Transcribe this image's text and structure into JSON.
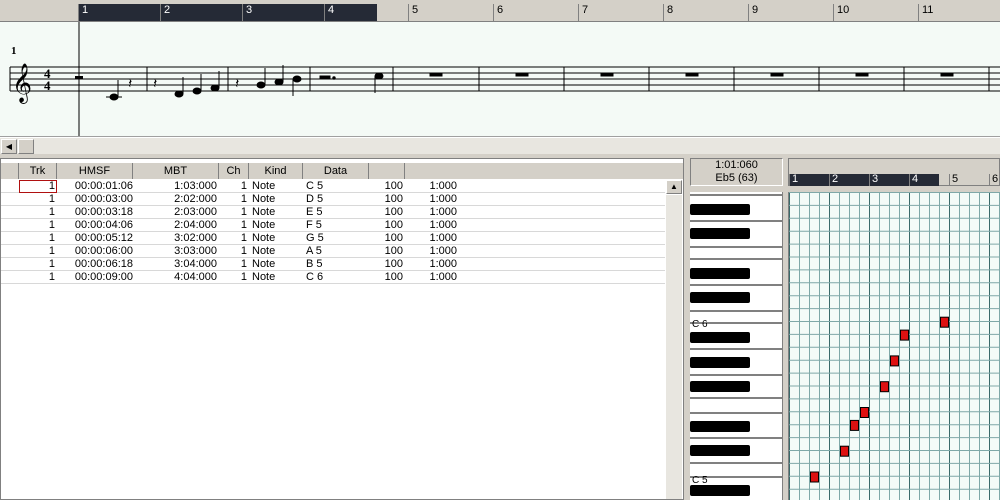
{
  "ruler": {
    "measures": [
      "1",
      "2",
      "3",
      "4",
      "5",
      "6",
      "7",
      "8",
      "9",
      "10",
      "11"
    ],
    "selected_range": [
      1,
      4
    ]
  },
  "staff": {
    "measure_number": "1",
    "time_signature": {
      "top": "4",
      "bottom": "4"
    }
  },
  "event_list": {
    "columns": [
      "Trk",
      "HMSF",
      "MBT",
      "Ch",
      "Kind",
      "Data"
    ],
    "rows": [
      {
        "trk": "1",
        "hmsf": "00:00:01:06",
        "mbt": "1:03:000",
        "ch": "1",
        "kind": "Note",
        "data": "C 5",
        "vel": "100",
        "dur": "1:000"
      },
      {
        "trk": "1",
        "hmsf": "00:00:03:00",
        "mbt": "2:02:000",
        "ch": "1",
        "kind": "Note",
        "data": "D 5",
        "vel": "100",
        "dur": "1:000"
      },
      {
        "trk": "1",
        "hmsf": "00:00:03:18",
        "mbt": "2:03:000",
        "ch": "1",
        "kind": "Note",
        "data": "E 5",
        "vel": "100",
        "dur": "1:000"
      },
      {
        "trk": "1",
        "hmsf": "00:00:04:06",
        "mbt": "2:04:000",
        "ch": "1",
        "kind": "Note",
        "data": "F 5",
        "vel": "100",
        "dur": "1:000"
      },
      {
        "trk": "1",
        "hmsf": "00:00:05:12",
        "mbt": "3:02:000",
        "ch": "1",
        "kind": "Note",
        "data": "G 5",
        "vel": "100",
        "dur": "1:000"
      },
      {
        "trk": "1",
        "hmsf": "00:00:06:00",
        "mbt": "3:03:000",
        "ch": "1",
        "kind": "Note",
        "data": "A 5",
        "vel": "100",
        "dur": "1:000"
      },
      {
        "trk": "1",
        "hmsf": "00:00:06:18",
        "mbt": "3:04:000",
        "ch": "1",
        "kind": "Note",
        "data": "B 5",
        "vel": "100",
        "dur": "1:000"
      },
      {
        "trk": "1",
        "hmsf": "00:00:09:00",
        "mbt": "4:04:000",
        "ch": "1",
        "kind": "Note",
        "data": "C 6",
        "vel": "100",
        "dur": "1:000"
      }
    ]
  },
  "piano_roll": {
    "position": "1:01:060",
    "pitch": "Eb5 (63)",
    "measures": [
      "1",
      "2",
      "3",
      "4",
      "5",
      "6"
    ],
    "key_labels": {
      "upper": "C 6",
      "lower": "C 5"
    }
  },
  "colors": {
    "ruler_selection": "#252a36",
    "note_fill": "#dd1111",
    "grid_line": "#7fa8a8",
    "staff_background": "#f4faf6"
  },
  "icons": {
    "scroll_left": "arrow-left-icon",
    "scroll_up": "arrow-up-icon"
  }
}
